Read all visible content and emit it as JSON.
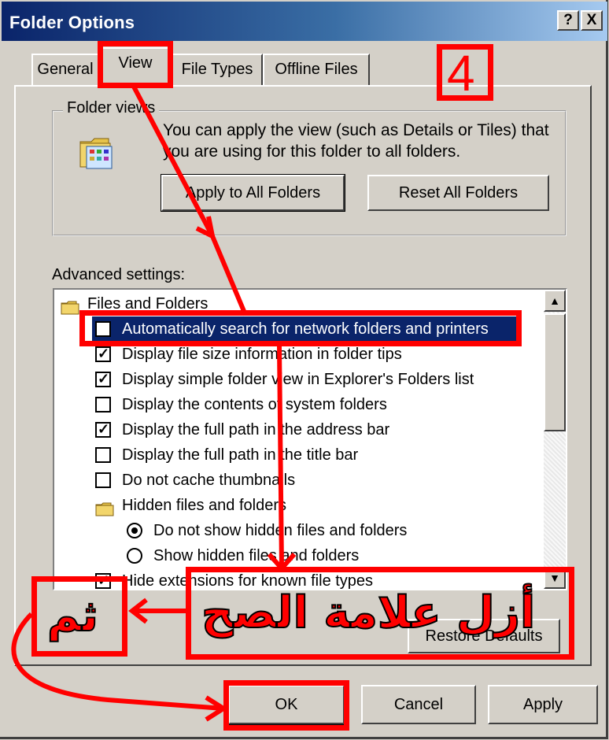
{
  "window": {
    "title": "Folder Options",
    "help_label": "?",
    "close_label": "X"
  },
  "tabs": [
    {
      "label": "General"
    },
    {
      "label": "View"
    },
    {
      "label": "File Types"
    },
    {
      "label": "Offline Files"
    }
  ],
  "folder_views": {
    "legend": "Folder views",
    "description": "You can apply the view (such as Details or Tiles) that you are using for this folder to all folders.",
    "apply_button": "Apply to All Folders",
    "reset_button": "Reset All Folders"
  },
  "advanced": {
    "label": "Advanced settings:",
    "items": [
      {
        "type": "folder",
        "label": "Files and Folders"
      },
      {
        "type": "checkbox",
        "checked": false,
        "selected": true,
        "label": "Automatically search for network folders and printers"
      },
      {
        "type": "checkbox",
        "checked": true,
        "label": "Display file size information in folder tips"
      },
      {
        "type": "checkbox",
        "checked": true,
        "label": "Display simple folder view in Explorer's Folders list"
      },
      {
        "type": "checkbox",
        "checked": false,
        "label": "Display the contents of system folders"
      },
      {
        "type": "checkbox",
        "checked": true,
        "label": "Display the full path in the address bar"
      },
      {
        "type": "checkbox",
        "checked": false,
        "label": "Display the full path in the title bar"
      },
      {
        "type": "checkbox",
        "checked": false,
        "label": "Do not cache thumbnails"
      },
      {
        "type": "folder",
        "label": "Hidden files and folders"
      },
      {
        "type": "radio",
        "checked": true,
        "label": "Do not show hidden files and folders"
      },
      {
        "type": "radio",
        "checked": false,
        "label": "Show hidden files and folders"
      },
      {
        "type": "checkbox",
        "checked": true,
        "label": "Hide extensions for known file types"
      }
    ],
    "restore_button": "Restore Defaults"
  },
  "footer": {
    "ok": "OK",
    "cancel": "Cancel",
    "apply": "Apply"
  },
  "annotations": {
    "step_number": "4",
    "instruction": "أزل علامة الصح",
    "then": "ثم",
    "color": "#ff0000"
  },
  "colors": {
    "selection": "#0a246a",
    "face": "#d4d0c8",
    "title_start": "#0a246a"
  }
}
